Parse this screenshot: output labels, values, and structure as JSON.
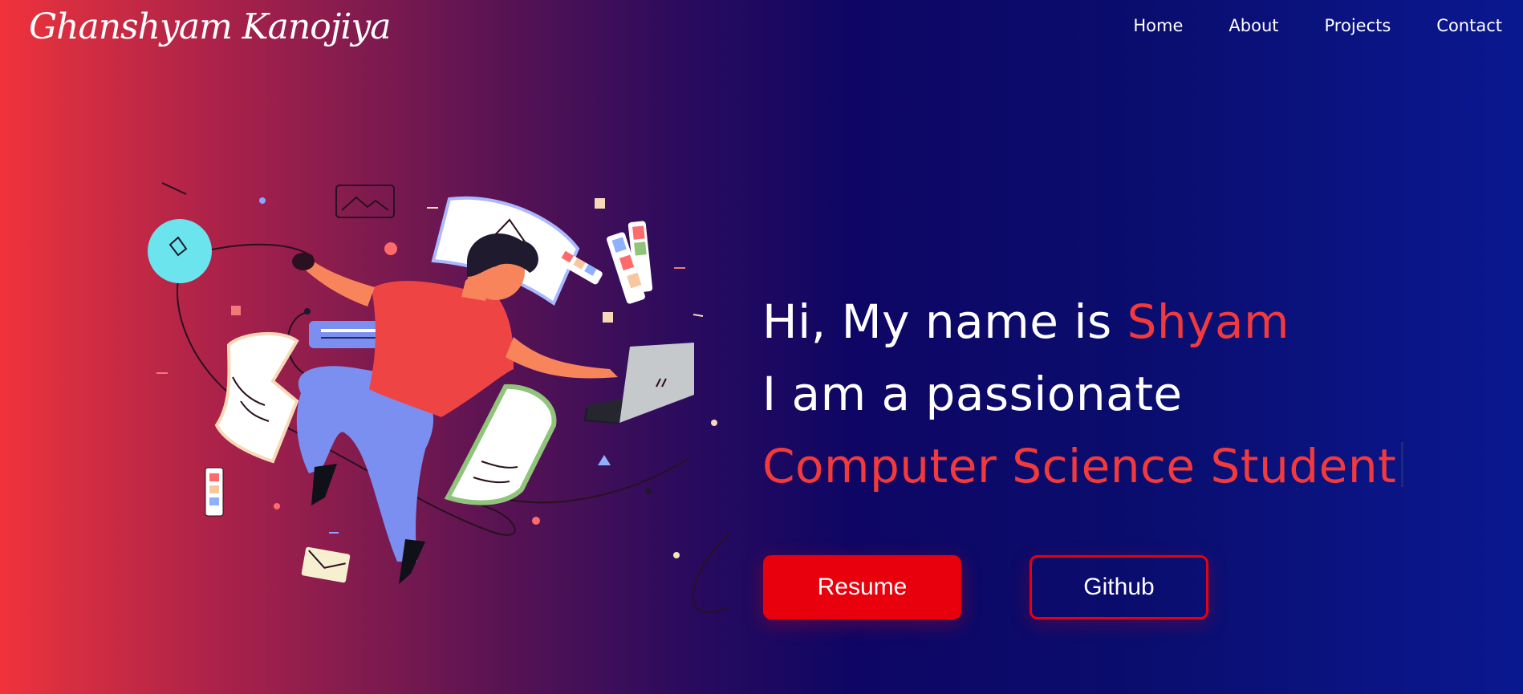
{
  "brand": {
    "name": "Ghanshyam Kanojiya"
  },
  "nav": {
    "items": [
      {
        "label": "Home"
      },
      {
        "label": "About"
      },
      {
        "label": "Projects"
      },
      {
        "label": "Contact"
      }
    ]
  },
  "hero": {
    "line1_prefix": "Hi, My name is ",
    "line1_name": "Shyam",
    "line2": "I am a passionate",
    "line3": "Computer Science Student",
    "resume_label": "Resume",
    "github_label": "Github"
  },
  "colors": {
    "accent": "#f23a3d",
    "button_red": "#e8000d",
    "bg_left": "#f2323b",
    "bg_right": "#0a1890"
  }
}
